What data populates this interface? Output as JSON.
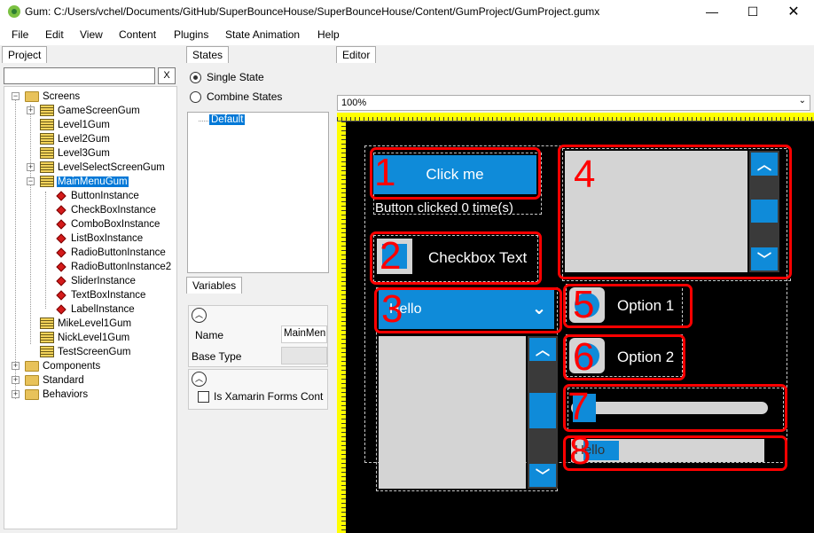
{
  "window": {
    "title": "Gum: C:/Users/vchel/Documents/GitHub/SuperBounceHouse/SuperBounceHouse/Content/GumProject/GumProject.gumx",
    "minimize": "—",
    "maximize": "☐",
    "close": "✕"
  },
  "menu": [
    "File",
    "Edit",
    "View",
    "Content",
    "Plugins",
    "State Animation",
    "Help"
  ],
  "project": {
    "tab": "Project",
    "search_value": "",
    "clear_label": "X",
    "tree": {
      "screens": "Screens",
      "screen_items": [
        "GameScreenGum",
        "Level1Gum",
        "Level2Gum",
        "Level3Gum",
        "LevelSelectScreenGum",
        "MainMenuGum"
      ],
      "instances": [
        "ButtonInstance",
        "CheckBoxInstance",
        "ComboBoxInstance",
        "ListBoxInstance",
        "RadioButtonInstance",
        "RadioButtonInstance2",
        "SliderInstance",
        "TextBoxInstance",
        "LabelInstance"
      ],
      "more_screens": [
        "MikeLevel1Gum",
        "NickLevel1Gum",
        "TestScreenGum"
      ],
      "components": "Components",
      "standard": "Standard",
      "behaviors": "Behaviors"
    }
  },
  "states": {
    "tab": "States",
    "single_state": "Single State",
    "combine_states": "Combine States",
    "default_state": "Default"
  },
  "variables": {
    "tab": "Variables",
    "name_label": "Name",
    "name_value": "MainMen",
    "base_type_label": "Base Type",
    "xamarin_label": "Is Xamarin Forms Cont"
  },
  "editor": {
    "tab": "Editor",
    "zoom": "100%",
    "button_text": "Click me",
    "button_clicked_text": "Button clicked 0 time(s)",
    "checkbox_text": "Checkbox Text",
    "combo_text": "Hello",
    "option1": "Option 1",
    "option2": "Option 2",
    "textbox_text": "Hello",
    "labels": [
      "1",
      "2",
      "3",
      "4",
      "5",
      "6",
      "7",
      "8"
    ]
  },
  "colors": {
    "accent_blue": "#0f8bd9",
    "selection": "#0078d7",
    "annotation_red": "#ff0000",
    "ruler_yellow": "#ffff00",
    "canvas": "#000000"
  }
}
